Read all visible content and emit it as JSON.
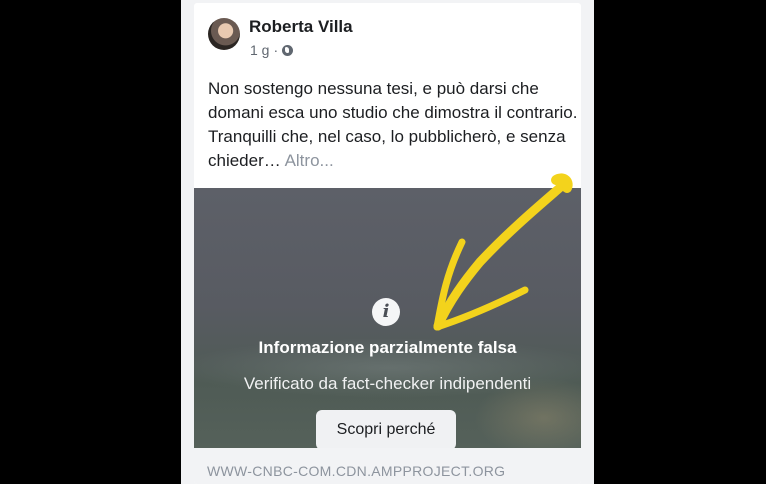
{
  "post": {
    "author": "Roberta Villa",
    "time": "1 g",
    "separator": "·",
    "privacy_icon": "globe-icon",
    "text": "Non sostengo nessuna tesi, e può darsi che domani esca uno studio che dimostra il contrario. Tranquilli che, nel caso, lo pubblicherò, e senza chieder…",
    "see_more": "Altro..."
  },
  "fact_check": {
    "icon": "info-icon",
    "icon_glyph": "i",
    "title": "Informazione parzialmente falsa",
    "subtitle": "Verificato da fact-checker indipendenti",
    "button_label": "Scopri perché"
  },
  "link": {
    "domain": "WWW-CNBC-COM.CDN.AMPPROJECT.ORG"
  },
  "annotation": {
    "type": "hand-drawn-arrow",
    "color": "#f3d31c"
  }
}
